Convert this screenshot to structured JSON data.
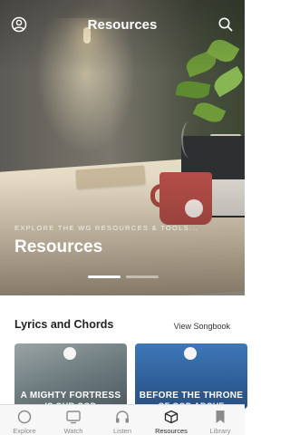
{
  "header": {
    "title": "Resources",
    "left_icon": "profile-circle-icon",
    "right_icon": "search-icon"
  },
  "hero": {
    "subtitle": "EXPLORE THE WG RESOURCES & TOOLS...",
    "title": "Resources",
    "carousel": {
      "total": 2,
      "active_index": 0
    }
  },
  "section": {
    "title": "Lyrics and Chords",
    "link": "View Songbook"
  },
  "cards": [
    {
      "title_line1": "A MIGHTY FORTRESS",
      "title_line2": "IS OUR GOD"
    },
    {
      "title_line1": "BEFORE THE THRONE",
      "title_line2": "OF GOD ABOVE"
    }
  ],
  "nav": {
    "items": [
      {
        "label": "Explore",
        "icon": "explore-circle-icon"
      },
      {
        "label": "Watch",
        "icon": "tv-icon"
      },
      {
        "label": "Listen",
        "icon": "headphones-icon"
      },
      {
        "label": "Resources",
        "icon": "box-icon"
      },
      {
        "label": "Library",
        "icon": "bookmark-icon"
      }
    ],
    "active": "Resources"
  },
  "colors": {
    "card1_bg": "#7b8a8c",
    "card2_bg": "#3c6da8",
    "mug": "#b24d47",
    "nav_active": "#2a2a2a",
    "nav_inactive": "#8b8b8b"
  }
}
